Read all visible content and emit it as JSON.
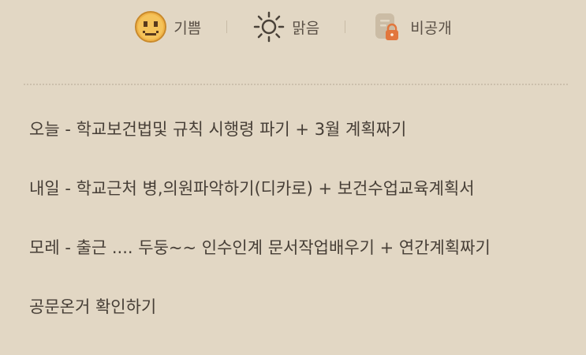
{
  "header": {
    "mood": {
      "icon": "smiley-face-icon",
      "label": "기쁨"
    },
    "weather": {
      "icon": "sun-icon",
      "label": "맑음"
    },
    "privacy": {
      "icon": "private-lock-icon",
      "label": "비공개"
    }
  },
  "colors": {
    "background": "#e2d7c4",
    "smiley": "#e9a63a",
    "text": "#463e36",
    "lock_badge": "#e2763c"
  },
  "entry": {
    "lines": [
      "오늘 - 학교보건법및 규칙 시행령 파기 + 3월 계획짜기",
      "내일 - 학교근처 병,의원파악하기(디카로) + 보건수업교육계획서",
      "모레 - 출근 .... 두둥~~ 인수인계 문서작업배우기 + 연간계획짜기",
      "공문온거 확인하기"
    ]
  }
}
